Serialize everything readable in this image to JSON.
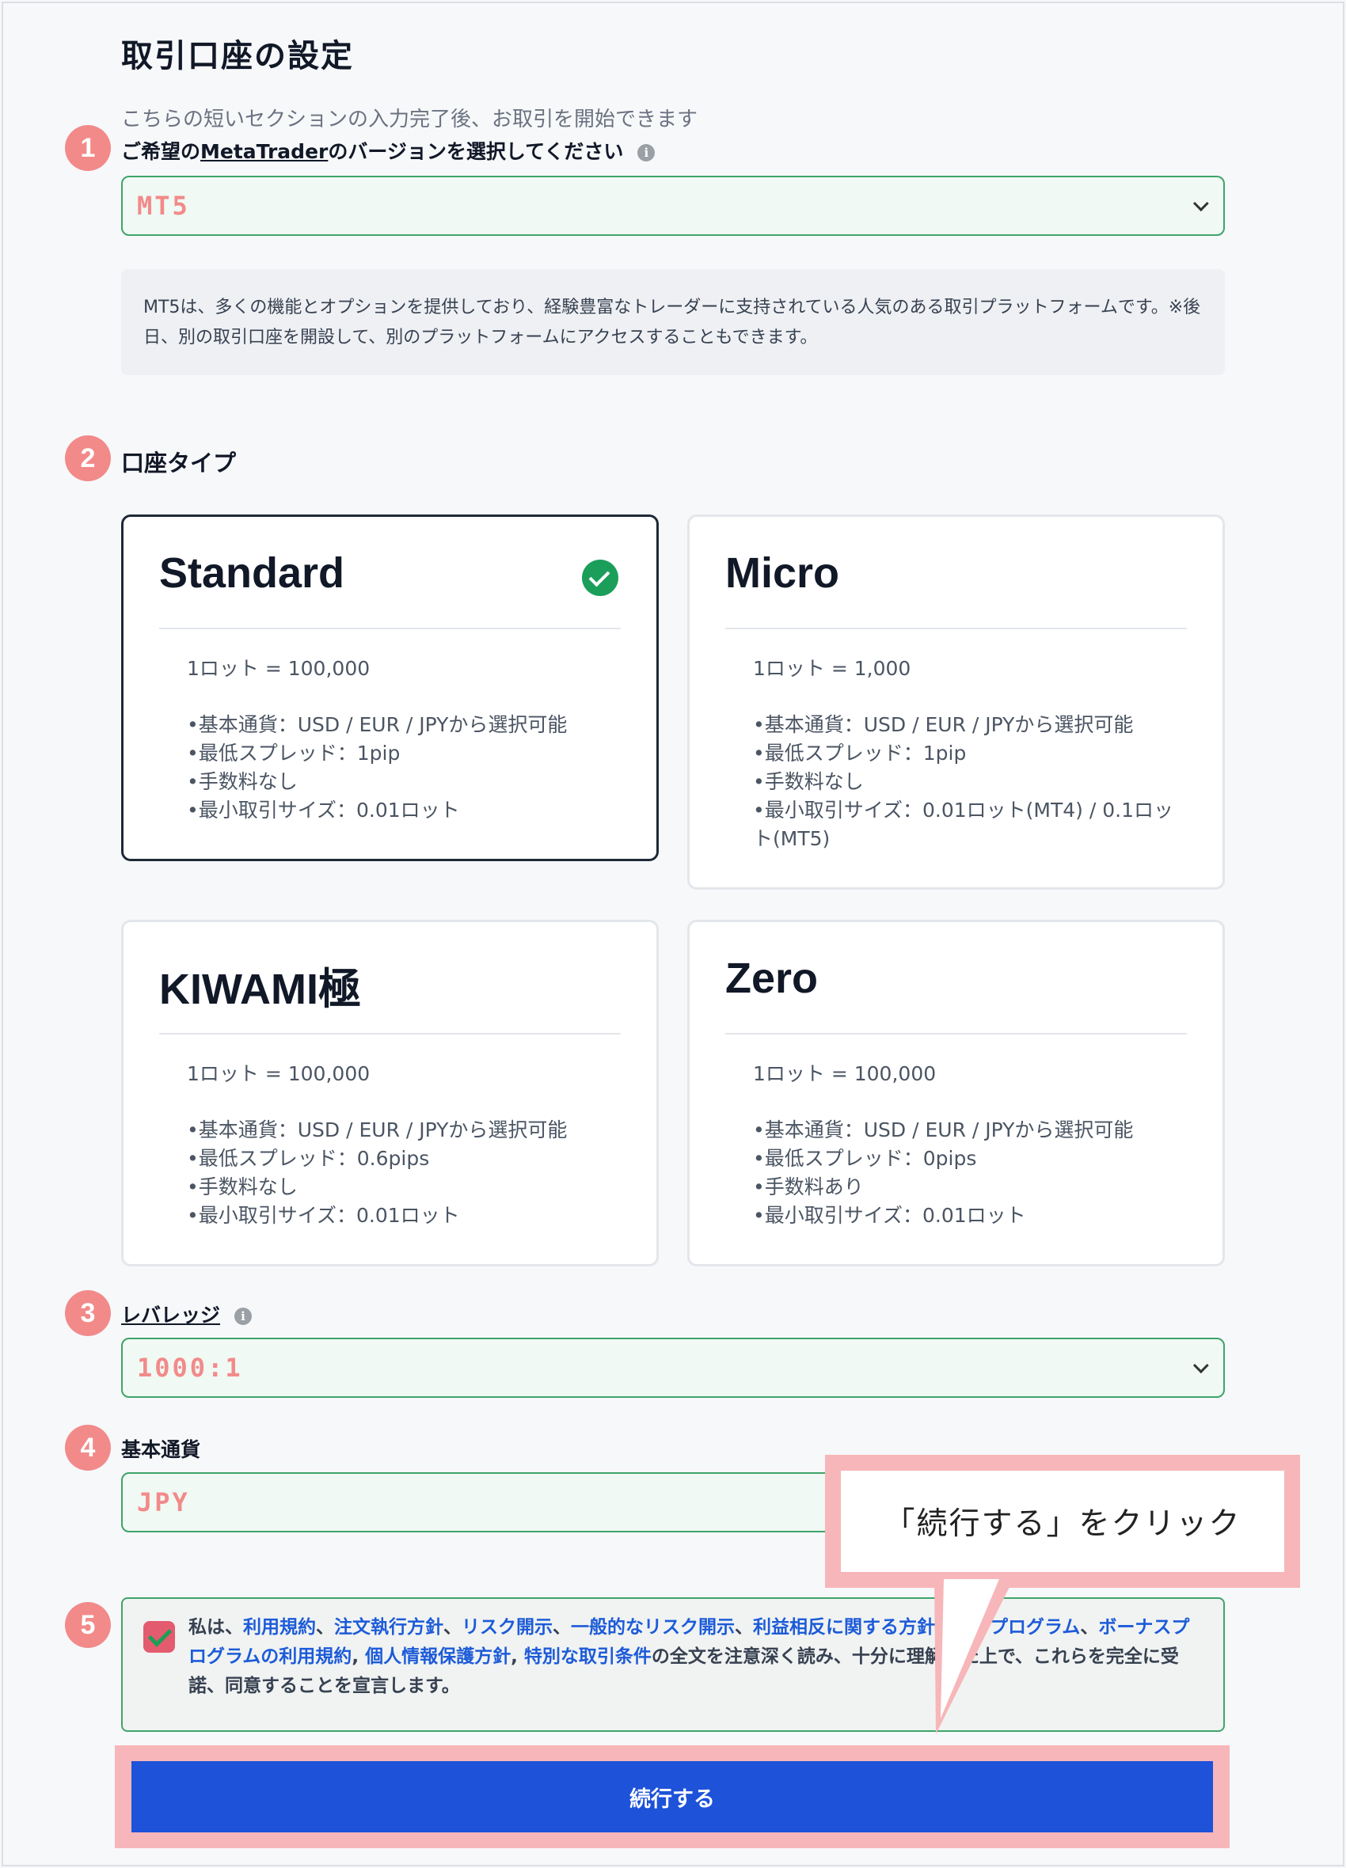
{
  "page": {
    "title": "取引口座の設定",
    "subtitle": "こちらの短いセクションの入力完了後、お取引を開始できます"
  },
  "steps": [
    "1",
    "2",
    "3",
    "4",
    "5"
  ],
  "platform": {
    "label_prefix": "ご希望の",
    "label_link": "MetaTrader",
    "label_suffix": "のバージョンを選択してください",
    "info": "i",
    "selected": "MT5",
    "description": "MT5は、多くの機能とオプションを提供しており、経験豊富なトレーダーに支持されている人気のある取引プラットフォームです。※後日、別の取引口座を開設して、別のプラットフォームにアクセスすることもできます。"
  },
  "account_type": {
    "label": "口座タイプ",
    "cards": [
      {
        "name": "Standard",
        "selected": true,
        "lot": "1ロット = 100,000",
        "features": [
          "•基本通貨：USD / EUR / JPYから選択可能",
          "•最低スプレッド：1pip",
          "•手数料なし",
          "•最小取引サイズ：0.01ロット"
        ]
      },
      {
        "name": "Micro",
        "selected": false,
        "lot": "1ロット = 1,000",
        "features": [
          "•基本通貨：USD / EUR / JPYから選択可能",
          "•最低スプレッド：1pip",
          "•手数料なし",
          "•最小取引サイズ：0.01ロット(MT4) / 0.1ロット(MT5)"
        ]
      },
      {
        "name": "KIWAMI極",
        "selected": false,
        "lot": "1ロット = 100,000",
        "features": [
          "•基本通貨：USD / EUR / JPYから選択可能",
          "•最低スプレッド：0.6pips",
          "•手数料なし",
          "•最小取引サイズ：0.01ロット"
        ]
      },
      {
        "name": "Zero",
        "selected": false,
        "lot": "1ロット = 100,000",
        "features": [
          "•基本通貨：USD / EUR / JPYから選択可能",
          "•最低スプレッド：0pips",
          "•手数料あり",
          "•最小取引サイズ：0.01ロット"
        ]
      }
    ]
  },
  "leverage": {
    "label": "レバレッジ",
    "info": "i",
    "selected": "1000:1"
  },
  "currency": {
    "label": "基本通貨",
    "selected": "JPY"
  },
  "consent": {
    "checked": true,
    "t0": "私は、",
    "l1": "利用規約",
    "s1": "、",
    "l2": "注文執行方針",
    "s2": "、",
    "l3": "リスク開示",
    "s3": "、",
    "l4": "一般的なリスク開示",
    "s4": "、",
    "l5": "利益相反に関する方針",
    "s5": "、",
    "l6": "紹介プログラム",
    "s6": "、",
    "l7": "ボーナスプログラムの利用規約",
    "s7": ", ",
    "l8": "個人情報保護方針",
    "s8": ", ",
    "l9": "特別な取引条件",
    "t1": "の全文を注意深く読み、十分に理解した上で、これらを完全に受諾、同意することを宣言します。"
  },
  "continue_button": "続行する",
  "callout": "「続行する」をクリック",
  "colors": {
    "accent_green": "#3ea46a",
    "step_pink": "#f28a8a",
    "button_blue": "#1d52d9",
    "highlight_pink": "#f7b6b9",
    "link_blue": "#1d5bd8"
  }
}
